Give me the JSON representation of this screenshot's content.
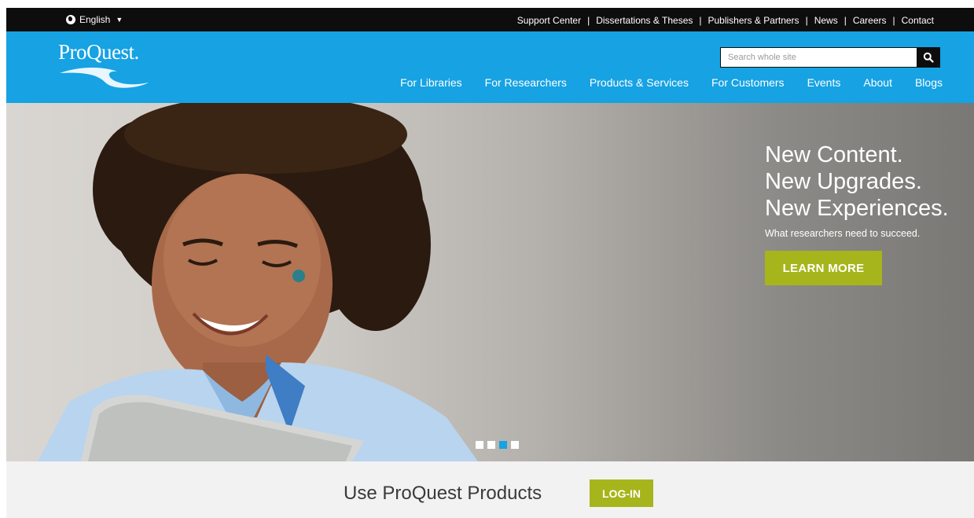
{
  "topbar": {
    "language": "English",
    "links": [
      "Support Center",
      "Dissertations & Theses",
      "Publishers & Partners",
      "News",
      "Careers",
      "Contact"
    ]
  },
  "header": {
    "logo_text": "ProQuest.",
    "search_placeholder": "Search whole site",
    "nav": [
      "For Libraries",
      "For Researchers",
      "Products & Services",
      "For Customers",
      "Events",
      "About",
      "Blogs"
    ]
  },
  "hero": {
    "headline": [
      "New Content.",
      "New Upgrades.",
      "New Experiences."
    ],
    "subheadline": "What researchers need to succeed.",
    "cta_label": "LEARN MORE",
    "slides_total": 4,
    "active_slide": 3
  },
  "band": {
    "text": "Use ProQuest Products",
    "login_label": "LOG-IN"
  },
  "colors": {
    "brand_blue": "#16a2e3",
    "accent_green": "#a6b51b",
    "topbar_black": "#0d0d0d"
  }
}
